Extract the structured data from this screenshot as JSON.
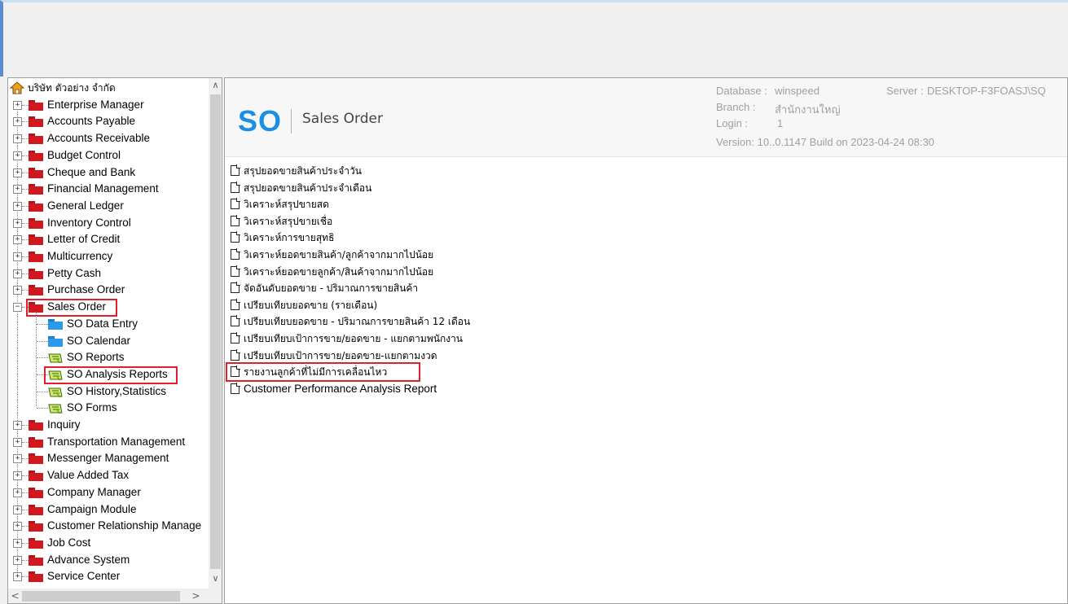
{
  "tree": {
    "root_label": "บริษัท ตัวอย่าง จำกัด",
    "items": [
      {
        "label": "Enterprise Manager"
      },
      {
        "label": "Accounts Payable"
      },
      {
        "label": "Accounts Receivable"
      },
      {
        "label": "Budget Control"
      },
      {
        "label": "Cheque and Bank"
      },
      {
        "label": "Financial Management"
      },
      {
        "label": "General Ledger"
      },
      {
        "label": "Inventory Control"
      },
      {
        "label": "Letter of Credit"
      },
      {
        "label": "Multicurrency"
      },
      {
        "label": "Petty Cash"
      },
      {
        "label": "Purchase Order"
      },
      {
        "label": "Sales Order"
      },
      {
        "label": "Inquiry"
      },
      {
        "label": "Transportation Management"
      },
      {
        "label": "Messenger Management"
      },
      {
        "label": "Value Added Tax"
      },
      {
        "label": "Company Manager"
      },
      {
        "label": "Campaign Module"
      },
      {
        "label": "Customer Relationship Manage"
      },
      {
        "label": "Job Cost"
      },
      {
        "label": "Advance System"
      },
      {
        "label": "Service Center"
      }
    ],
    "sales_order_children": [
      {
        "label": "SO Data Entry",
        "icon": "folder-blue-icon"
      },
      {
        "label": "SO Calendar",
        "icon": "folder-blue-icon"
      },
      {
        "label": "SO Reports",
        "icon": "report-icon"
      },
      {
        "label": "SO Analysis Reports",
        "icon": "report-icon"
      },
      {
        "label": "SO History,Statistics",
        "icon": "report-icon"
      },
      {
        "label": "SO Forms",
        "icon": "report-icon"
      }
    ]
  },
  "header": {
    "logo": "SO",
    "title": "Sales Order",
    "database_label": "Database :",
    "database_value": "winspeed",
    "server_label": "Server :",
    "server_value": "DESKTOP-F3FOASJ\\SQ",
    "branch_label": "Branch :",
    "branch_value": "สำนักงานใหญ่",
    "login_label": "Login :",
    "login_value": "1",
    "version": "Version: 10..0.1147  Build on 2023-04-24 08:30"
  },
  "reports": [
    "สรุปยอดขายสินค้าประจำวัน",
    "สรุปยอดขายสินค้าประจำเดือน",
    "วิเคราะห์สรุปขายสด",
    "วิเคราะห์สรุปขายเชื่อ",
    "วิเคราะห์การขายสุทธิ",
    "วิเคราะห์ยอดขายสินค้า/ลูกค้าจากมากไปน้อย",
    "วิเคราะห์ยอดขายลูกค้า/สินค้าจากมากไปน้อย",
    "จัดอันดับยอดขาย - ปริมาณการขายสินค้า",
    "เปรียบเทียบยอดขาย (รายเดือน)",
    "เปรียบเทียบยอดขาย - ปริมาณการขายสินค้า  12 เดือน",
    "เปรียบเทียบเป้าการขาย/ยอดขาย - แยกตามพนักงาน",
    "เปรียบเทียบเป้าการขาย/ยอดขาย-แยกตามงวด",
    "รายงานลูกค้าที่ไม่มีการเคลื่อนไหว",
    "Customer Performance Analysis Report"
  ],
  "colors": {
    "accent": "#1a8fe3",
    "highlight": "#e0202a",
    "folder": "#d0181f"
  }
}
